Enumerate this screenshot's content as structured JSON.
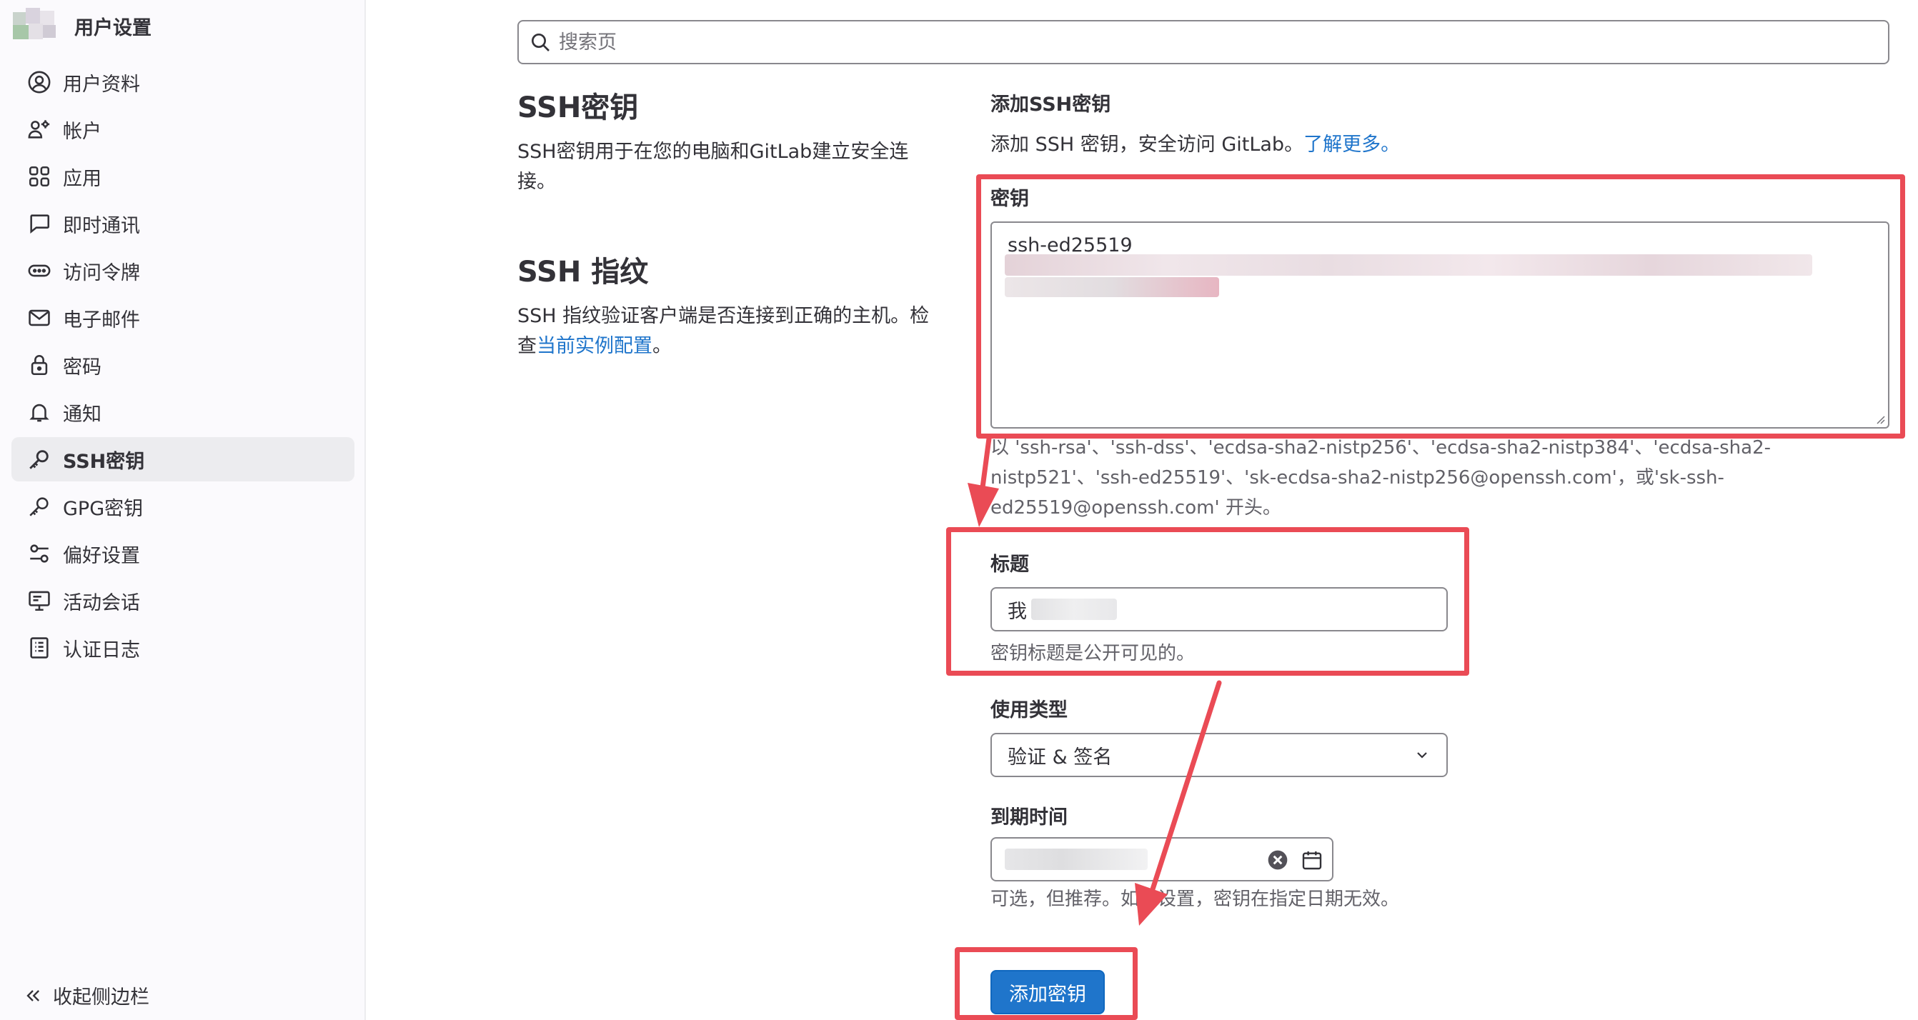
{
  "sidebar": {
    "title": "用户设置",
    "items": [
      {
        "label": "用户资料",
        "icon": "user-icon"
      },
      {
        "label": "帐户",
        "icon": "account-icon"
      },
      {
        "label": "应用",
        "icon": "applications-icon"
      },
      {
        "label": "即时通讯",
        "icon": "chat-icon"
      },
      {
        "label": "访问令牌",
        "icon": "token-icon"
      },
      {
        "label": "电子邮件",
        "icon": "mail-icon"
      },
      {
        "label": "密码",
        "icon": "lock-icon"
      },
      {
        "label": "通知",
        "icon": "bell-icon"
      },
      {
        "label": "SSH密钥",
        "icon": "key-icon",
        "active": true
      },
      {
        "label": "GPG密钥",
        "icon": "key-icon"
      },
      {
        "label": "偏好设置",
        "icon": "preferences-icon"
      },
      {
        "label": "活动会话",
        "icon": "monitor-icon"
      },
      {
        "label": "认证日志",
        "icon": "log-icon"
      }
    ],
    "collapse_label": "收起侧边栏"
  },
  "search": {
    "placeholder": "搜索页"
  },
  "ssh_keys_section": {
    "title": "SSH密钥",
    "description": "SSH密钥用于在您的电脑和GitLab建立安全连接。"
  },
  "fingerprint_section": {
    "title": "SSH 指纹",
    "description_prefix": "SSH 指纹验证客户端是否连接到正确的主机。检查",
    "link": "当前实例配置",
    "description_suffix": "。"
  },
  "form": {
    "heading": "添加SSH密钥",
    "intro": "添加 SSH 密钥，安全访问 GitLab。",
    "intro_link": "了解更多。",
    "key_label": "密钥",
    "key_value": "ssh-ed25519",
    "key_help": "以 'ssh-rsa'、'ssh-dss'、'ecdsa-sha2-nistp256'、'ecdsa-sha2-nistp384'、'ecdsa-sha2-nistp521'、'ssh-ed25519'、'sk-ecdsa-sha2-nistp256@openssh.com'，或'sk-ssh-ed25519@openssh.com' 开头。",
    "title_label": "标题",
    "title_value": "我",
    "title_help": "密钥标题是公开可见的。",
    "usage_label": "使用类型",
    "usage_value": "验证 & 签名",
    "expiry_label": "到期时间",
    "expiry_help": "可选，但推荐。如果设置，密钥在指定日期无效。",
    "submit_label": "添加密钥"
  },
  "colors": {
    "accent": "#1f75cb",
    "annotation": "#ea4b55",
    "sidebar_bg": "#fbfafd"
  }
}
